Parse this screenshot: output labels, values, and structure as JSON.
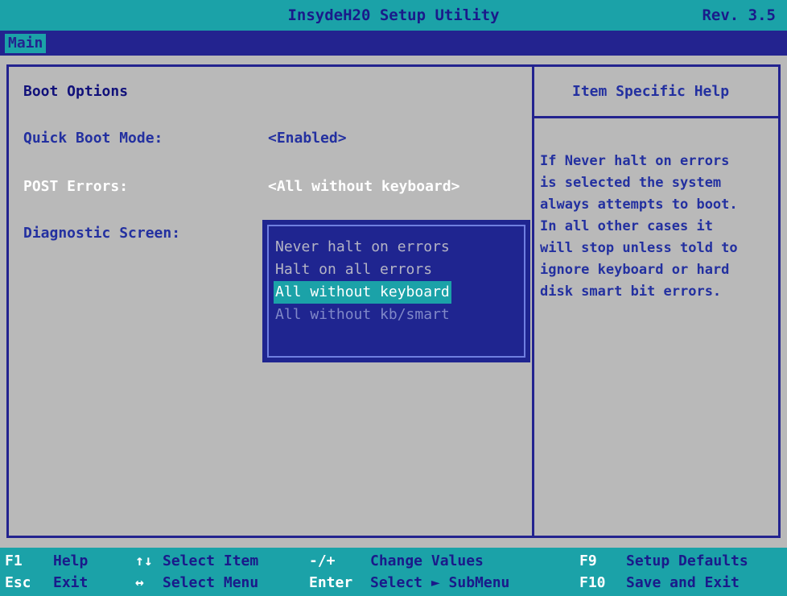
{
  "title": "InsydeH20 Setup Utility",
  "revision": "Rev. 3.5",
  "menu": {
    "tabs": [
      {
        "label": "Main",
        "active": true
      }
    ]
  },
  "main": {
    "section_title": "Boot Options",
    "options": [
      {
        "label": "Quick Boot Mode:",
        "value": "<Enabled>"
      },
      {
        "label": "POST Errors:",
        "value": "<All without keyboard>",
        "selected": true
      },
      {
        "label": "Diagnostic Screen:",
        "value": ""
      }
    ]
  },
  "popup": {
    "items": [
      {
        "label": "Never halt on errors"
      },
      {
        "label": "Halt on all errors"
      },
      {
        "label": "All without keyboard",
        "selected": true
      },
      {
        "label": "All without kb/smart"
      }
    ]
  },
  "help": {
    "title": "Item Specific Help",
    "text": "If Never halt on errors\nis selected the system\nalways attempts to boot.\nIn all other cases it\nwill stop unless told to\nignore keyboard or hard\ndisk smart bit errors."
  },
  "footer": {
    "row1": [
      {
        "key": "F1",
        "desc": "Help"
      },
      {
        "key": "↑↓",
        "desc": "Select Item"
      },
      {
        "key": "-/+",
        "desc": "Change Values"
      },
      {
        "key": "F9",
        "desc": "Setup Defaults"
      }
    ],
    "row2": [
      {
        "key": "Esc",
        "desc": "Exit"
      },
      {
        "key": "↔",
        "desc": "Select Menu"
      },
      {
        "key": "Enter",
        "desc": "Select ► SubMenu"
      },
      {
        "key": "F10",
        "desc": "Save and Exit"
      }
    ]
  },
  "colors": {
    "background": "#b9b9b9",
    "teal": "#1ba2a8",
    "navy": "#23238f",
    "text_blue": "#2330a0"
  }
}
